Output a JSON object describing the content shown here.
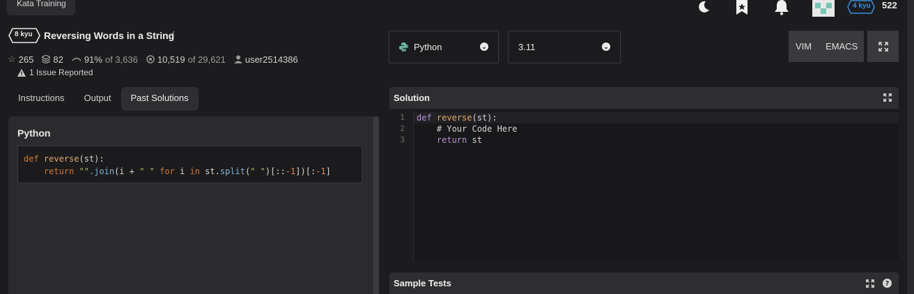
{
  "top": {
    "kata_training": "Kata Training",
    "level": "4 kyu",
    "honor": "522"
  },
  "kata": {
    "kyu": "8 kyu",
    "title": "Reversing Words in a String",
    "check": "✓",
    "stars": "265",
    "collections": "82",
    "satisfaction": "91%",
    "satisfaction_of": "of 3,636",
    "completed": "10,519",
    "completed_of": "of 29,621",
    "author": "user2514386",
    "issues": "1 Issue Reported"
  },
  "tabs": [
    {
      "label": "Instructions"
    },
    {
      "label": "Output"
    },
    {
      "label": "Past Solutions"
    }
  ],
  "past_solution": {
    "language": "Python",
    "code_line1_kw": "def",
    "code_line1_fn": "reverse",
    "code_line1_rest": "(st):",
    "code_line2": "return",
    "code_line2_str1": "\"\"",
    "code_line2_join": ".join",
    "code_line2_a": "(i + ",
    "code_line2_str2": "\" \"",
    "code_line2_for": "for",
    "code_line2_i": " i ",
    "code_line2_in": "in",
    "code_line2_b": " st.",
    "code_line2_split": "split",
    "code_line2_c": "(",
    "code_line2_str3": "\" \"",
    "code_line2_d": ")[::",
    "code_line2_n1": "-1",
    "code_line2_e": "])[:",
    "code_line2_n2": "-1",
    "code_line2_f": "]"
  },
  "controls": {
    "language": "Python",
    "version": "3.11",
    "mode_vim": "VIM",
    "mode_emacs": "EMACS"
  },
  "solution": {
    "title": "Solution",
    "line_numbers": [
      "1",
      "2",
      "3"
    ],
    "l1_kw": "def",
    "l1_fn": "reverse",
    "l1_rest": "(st):",
    "l2": "# Your Code Here",
    "l3_kw": "return",
    "l3_rest": " st"
  },
  "sample_tests": {
    "title": "Sample Tests"
  }
}
